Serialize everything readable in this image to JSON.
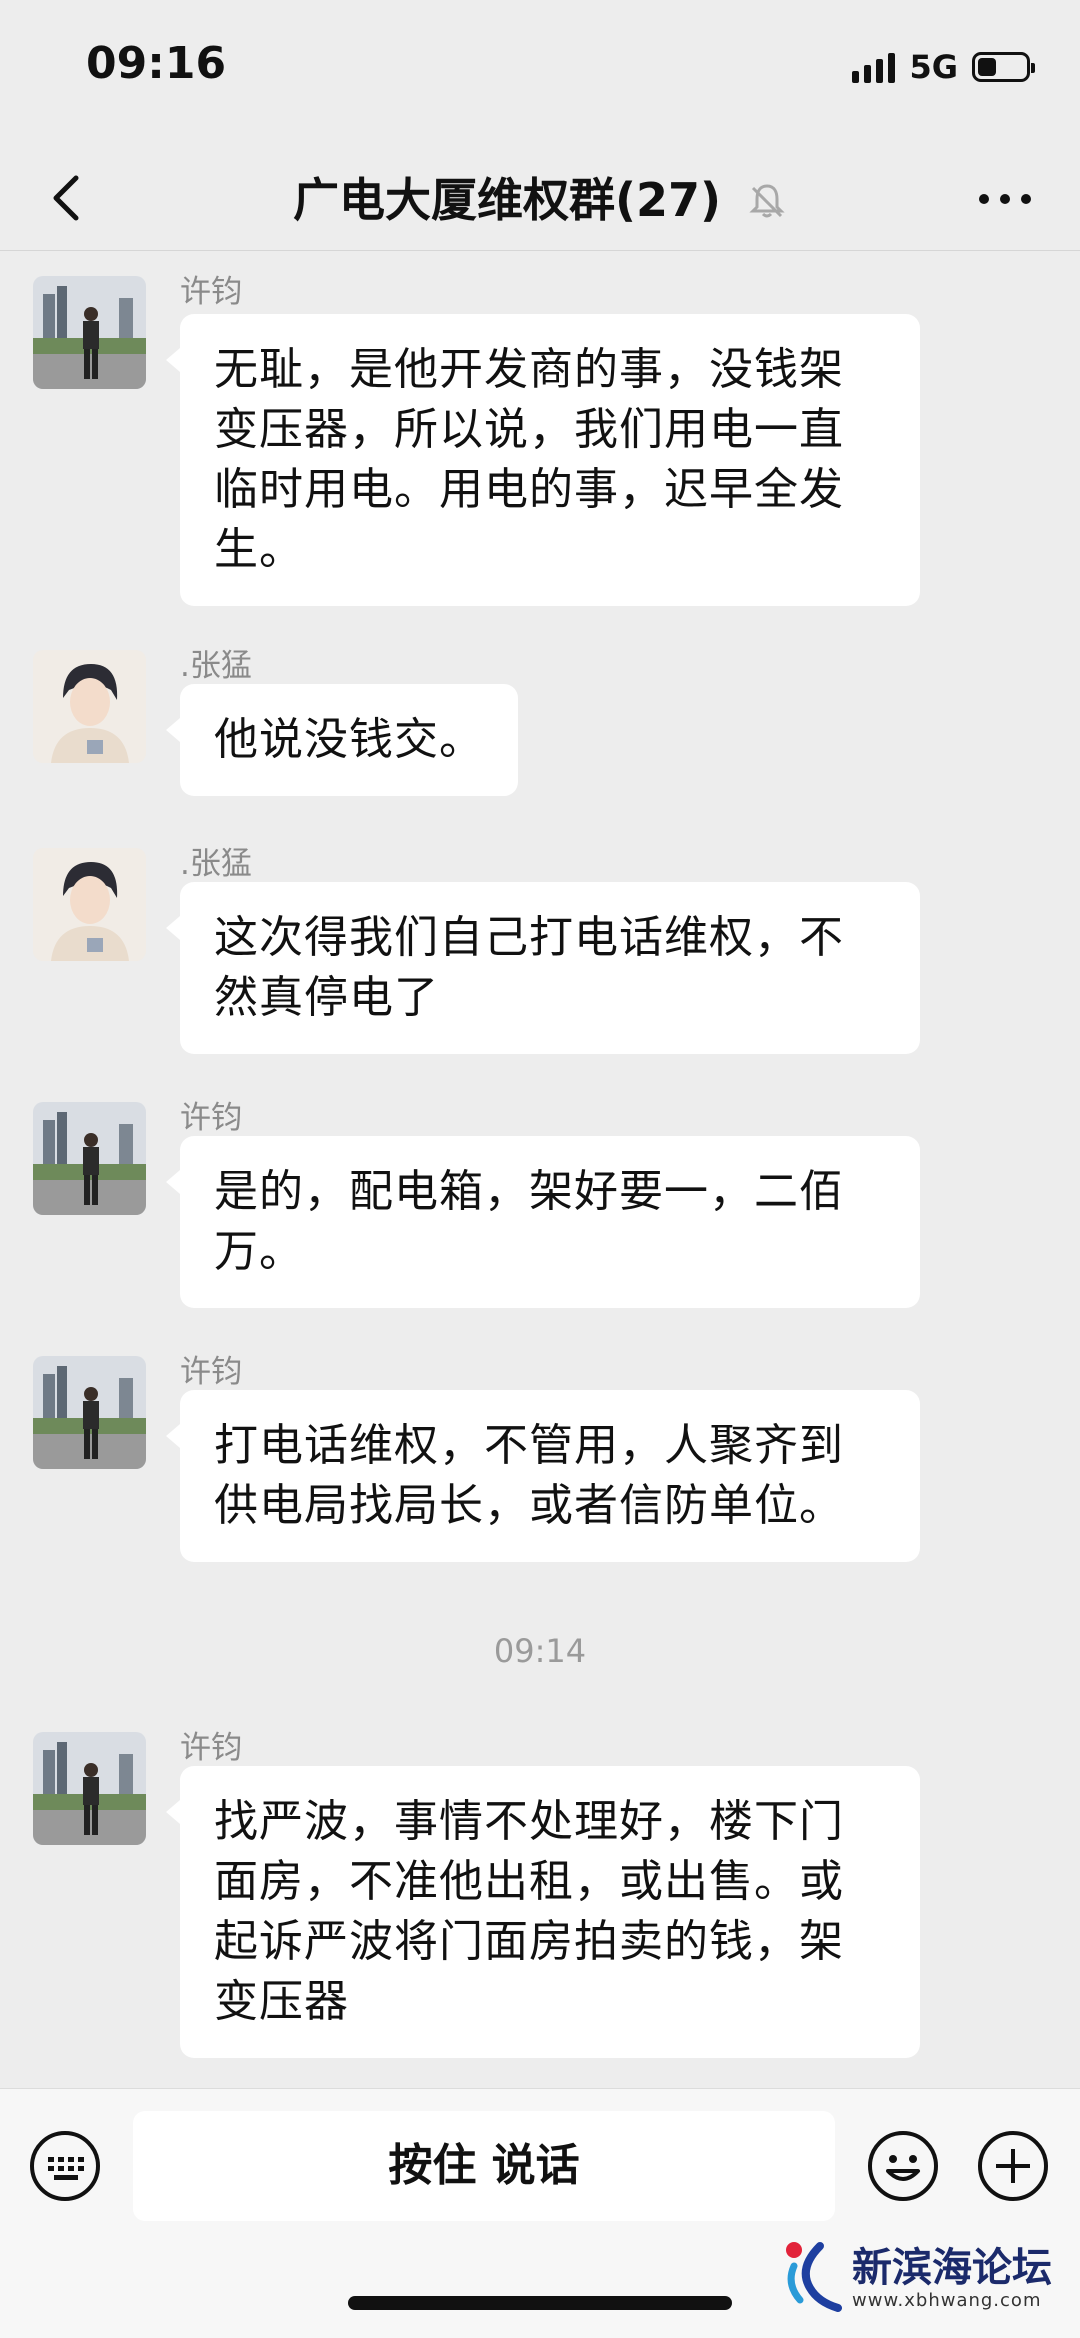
{
  "status": {
    "time": "09:16",
    "network": "5G"
  },
  "nav": {
    "title": "广电大厦维权群(27)"
  },
  "messages": [
    {
      "sender": "许钧",
      "text": "无耻，是他开发商的事，没钱架变压器，所以说，我们用电一直临时用电。用电的事，迟早全发生。"
    },
    {
      "sender": ".张猛",
      "text": "他说没钱交。"
    },
    {
      "sender": ".张猛",
      "text": "这次得我们自己打电话维权，不然真停电了"
    },
    {
      "sender": "许钧",
      "text": "是的，配电箱，架好要一，二佰万。"
    },
    {
      "sender": "许钧",
      "text": "打电话维权，不管用，人聚齐到供电局找局长，或者信防单位。"
    },
    {
      "sender": "许钧",
      "text": "找严波，事情不处理好，楼下门面房，不准他出租，或出售。或起诉严波将门面房拍卖的钱，架变压器"
    }
  ],
  "timestamp": "09:14",
  "input": {
    "talk_label": "按住 说话"
  },
  "watermark": {
    "name": "新滨海论坛",
    "url": "www.xbhwang.com"
  },
  "colors": {
    "background": "#ededed",
    "bubble": "#ffffff"
  },
  "icons": [
    "back-arrow-icon",
    "mute-bell-icon",
    "more-icon",
    "keyboard-icon",
    "emoji-icon",
    "plus-icon"
  ]
}
